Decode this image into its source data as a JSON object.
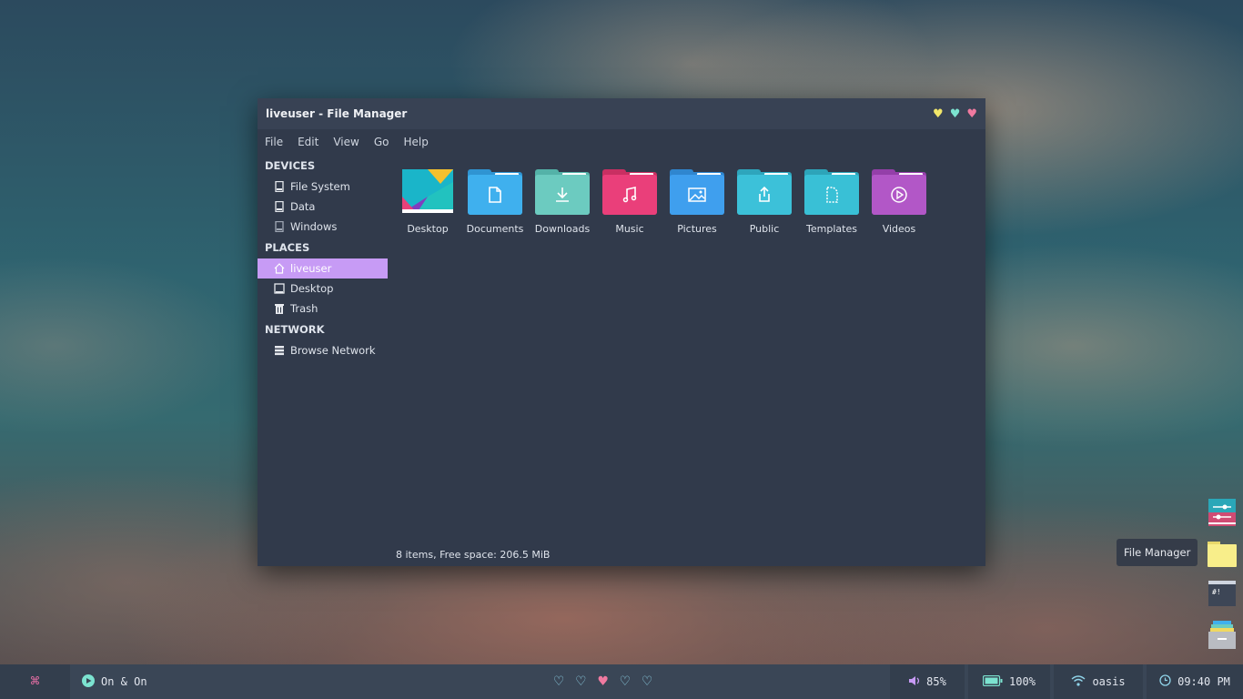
{
  "window": {
    "title": "liveuser - File Manager",
    "buttons": [
      "minimize",
      "maximize",
      "close"
    ]
  },
  "menu": [
    "File",
    "Edit",
    "View",
    "Go",
    "Help"
  ],
  "sidebar": {
    "devices_header": "DEVICES",
    "devices": [
      "File System",
      "Data",
      "Windows"
    ],
    "places_header": "PLACES",
    "places": [
      "liveuser",
      "Desktop",
      "Trash"
    ],
    "network_header": "NETWORK",
    "network": [
      "Browse Network"
    ],
    "active": "liveuser"
  },
  "items": [
    {
      "label": "Desktop",
      "icon": "desktop-folder-icon",
      "color": "#1ab5c9"
    },
    {
      "label": "Documents",
      "icon": "document-icon",
      "color": "#3fb0ee"
    },
    {
      "label": "Downloads",
      "icon": "download-icon",
      "color": "#6ccbc0"
    },
    {
      "label": "Music",
      "icon": "music-note-icon",
      "color": "#ea3f7a"
    },
    {
      "label": "Pictures",
      "icon": "image-icon",
      "color": "#3f9fee"
    },
    {
      "label": "Public",
      "icon": "share-icon",
      "color": "#3cc1d9"
    },
    {
      "label": "Templates",
      "icon": "template-icon",
      "color": "#39c0d6"
    },
    {
      "label": "Videos",
      "icon": "play-icon",
      "color": "#b257c7"
    }
  ],
  "status": "8 items, Free space: 206.5 MiB",
  "tooltip": "File Manager",
  "panel": {
    "launcher_glyph": "⌘",
    "music": "On & On",
    "workspaces": 5,
    "active_workspace": 3,
    "volume": "85%",
    "battery": "100%",
    "wifi": "oasis",
    "clock": "09:40 PM"
  }
}
